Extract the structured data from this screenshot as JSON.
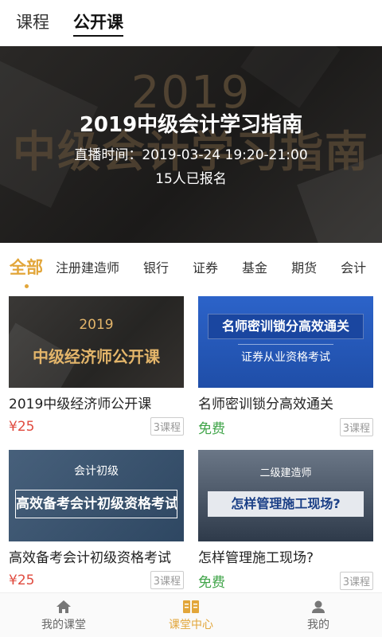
{
  "top_tabs": [
    {
      "label": "课程",
      "active": false
    },
    {
      "label": "公开课",
      "active": true
    }
  ],
  "banner": {
    "ghost_year": "2019",
    "ghost_title": "中级会计学习指南",
    "title": "2019中级会计学习指南",
    "time": "直播时间：2019-03-24  19:20-21:00",
    "enrolled": "15人已报名"
  },
  "categories": [
    "全部",
    "注册建造师",
    "银行",
    "证券",
    "基金",
    "期货",
    "会计"
  ],
  "courses": [
    {
      "name": "2019中级经济师公开课",
      "price": "¥25",
      "price_type": "paid",
      "count": "3课程",
      "thumb_year": "2019",
      "thumb_title": "中级经济师公开课"
    },
    {
      "name": "名师密训锁分高效通关",
      "price": "免费",
      "price_type": "free",
      "count": "3课程",
      "thumb_title": "名师密训锁分高效通关",
      "thumb_sub": "证券从业资格考试"
    },
    {
      "name": "高效备考会计初级资格考试",
      "price": "¥25",
      "price_type": "paid",
      "count": "3课程",
      "thumb_top": "会计初级",
      "thumb_title": "高效备考会计初级资格考试"
    },
    {
      "name": "怎样管理施工现场?",
      "price": "免费",
      "price_type": "free",
      "count": "3课程",
      "thumb_top": "二级建造师",
      "thumb_title": "怎样管理施工现场?"
    }
  ],
  "bottom_nav": [
    {
      "label": "我的课堂",
      "icon": "home-icon",
      "active": false
    },
    {
      "label": "课堂中心",
      "icon": "book-icon",
      "active": true
    },
    {
      "label": "我的",
      "icon": "user-icon",
      "active": false
    }
  ],
  "colors": {
    "accent": "#e2a63a",
    "paid": "#e04b3f",
    "free": "#3fa448"
  }
}
